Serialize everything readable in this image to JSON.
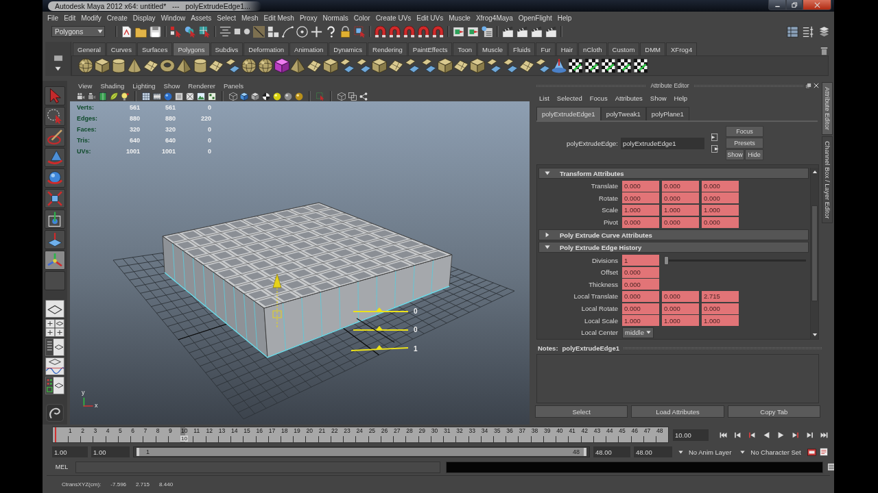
{
  "window": {
    "title": "Autodesk Maya 2012 x64: untitled*   ---   polyExtrudeEdge1..."
  },
  "menu_bar": [
    "File",
    "Edit",
    "Modify",
    "Create",
    "Display",
    "Window",
    "Assets",
    "Select",
    "Mesh",
    "Edit Mesh",
    "Proxy",
    "Normals",
    "Color",
    "Create UVs",
    "Edit UVs",
    "Muscle",
    "Xfrog4Maya",
    "OpenFlight",
    "Help"
  ],
  "status_line": {
    "menu_set": "Polygons"
  },
  "shelf": {
    "tabs": [
      {
        "label": "General",
        "selected": false
      },
      {
        "label": "Curves",
        "selected": false
      },
      {
        "label": "Surfaces",
        "selected": false
      },
      {
        "label": "Polygons",
        "selected": true
      },
      {
        "label": "Subdivs",
        "selected": false
      },
      {
        "label": "Deformation",
        "selected": false
      },
      {
        "label": "Animation",
        "selected": false
      },
      {
        "label": "Dynamics",
        "selected": false
      },
      {
        "label": "Rendering",
        "selected": false
      },
      {
        "label": "PaintEffects",
        "selected": false
      },
      {
        "label": "Toon",
        "selected": false
      },
      {
        "label": "Muscle",
        "selected": false
      },
      {
        "label": "Fluids",
        "selected": false
      },
      {
        "label": "Fur",
        "selected": false
      },
      {
        "label": "Hair",
        "selected": false
      },
      {
        "label": "nCloth",
        "selected": false
      },
      {
        "label": "Custom",
        "selected": false
      },
      {
        "label": "DMM",
        "selected": false
      },
      {
        "label": "XFrog4",
        "selected": false
      }
    ]
  },
  "toolbox": {
    "tools": [
      {
        "selected": false
      },
      {
        "selected": false
      },
      {
        "selected": false
      },
      {
        "selected": false
      },
      {
        "selected": false
      },
      {
        "selected": false
      },
      {
        "selected": false
      },
      {
        "selected": false
      },
      {
        "selected": true
      },
      {
        "selected": false
      }
    ]
  },
  "viewport": {
    "menu": [
      "View",
      "Shading",
      "Lighting",
      "Show",
      "Renderer",
      "Panels"
    ],
    "hud": [
      {
        "label": "Verts:",
        "values": [
          "561",
          "561",
          "0"
        ]
      },
      {
        "label": "Edges:",
        "values": [
          "880",
          "880",
          "220"
        ]
      },
      {
        "label": "Faces:",
        "values": [
          "320",
          "320",
          "0"
        ]
      },
      {
        "label": "Tris:",
        "values": [
          "640",
          "640",
          "0"
        ]
      },
      {
        "label": "UVs:",
        "values": [
          "1001",
          "1001",
          "0"
        ]
      }
    ],
    "manipulator_values": [
      "0",
      "0",
      "1"
    ],
    "axis_labels": [
      "y",
      "x"
    ]
  },
  "attribute_editor": {
    "title": "Attribute Editor",
    "menu": [
      "List",
      "Selected",
      "Focus",
      "Attributes",
      "Show",
      "Help"
    ],
    "tabs": [
      {
        "label": "polyExtrudeEdge1",
        "selected": true
      },
      {
        "label": "polyTweak1",
        "selected": false
      },
      {
        "label": "polyPlane1",
        "selected": false
      }
    ],
    "node_label": "polyExtrudeEdge:",
    "node_name": "polyExtrudeEdge1",
    "buttons": [
      "Focus",
      "Presets",
      "Show",
      "Hide"
    ],
    "sections": [
      {
        "title": "Transform Attributes",
        "expanded": true,
        "rows": [
          {
            "kind": "vector",
            "label": "Translate",
            "values": [
              "0.000",
              "0.000",
              "0.000"
            ]
          },
          {
            "kind": "vector",
            "label": "Rotate",
            "values": [
              "0.000",
              "0.000",
              "0.000"
            ]
          },
          {
            "kind": "vector",
            "label": "Scale",
            "values": [
              "1.000",
              "1.000",
              "1.000"
            ]
          },
          {
            "kind": "vector",
            "label": "Pivot",
            "values": [
              "0.000",
              "0.000",
              "0.000"
            ]
          }
        ]
      },
      {
        "title": "Poly Extrude Curve Attributes",
        "expanded": false
      },
      {
        "title": "Poly Extrude Edge History",
        "expanded": true,
        "rows": [
          {
            "kind": "slider",
            "label": "Divisions",
            "values": [
              "1"
            ],
            "level": 0
          },
          {
            "kind": "vector",
            "label": "Offset",
            "values": [
              "0.000"
            ]
          },
          {
            "kind": "vector",
            "label": "Thickness",
            "values": [
              "0.000"
            ]
          },
          {
            "kind": "vector",
            "label": "Local Translate",
            "values": [
              "0.000",
              "0.000",
              "2.715"
            ]
          },
          {
            "kind": "vector",
            "label": "Local Rotate",
            "values": [
              "0.000",
              "0.000",
              "0.000"
            ]
          },
          {
            "kind": "vector",
            "label": "Local Scale",
            "values": [
              "1.000",
              "1.000",
              "1.000"
            ]
          },
          {
            "kind": "dropdown",
            "label": "Local Center",
            "values": [
              "middle"
            ]
          }
        ]
      }
    ],
    "notes": {
      "label": "Notes:",
      "node": "polyExtrudeEdge1"
    },
    "bottom_buttons": [
      "Select",
      "Load Attributes",
      "Copy Tab"
    ]
  },
  "side_tabs": [
    {
      "label": "Attribute Editor",
      "selected": true
    },
    {
      "label": "Channel Box / Layer Editor",
      "selected": false
    }
  ],
  "time_slider": {
    "ticks": [
      {
        "label": "1",
        "selected": false
      },
      {
        "label": "2",
        "selected": false
      },
      {
        "label": "3",
        "selected": false
      },
      {
        "label": "4",
        "selected": false
      },
      {
        "label": "5",
        "selected": false
      },
      {
        "label": "6",
        "selected": false
      },
      {
        "label": "7",
        "selected": false
      },
      {
        "label": "8",
        "selected": false
      },
      {
        "label": "9",
        "selected": false
      },
      {
        "label": "10",
        "selected": true
      },
      {
        "label": "11",
        "selected": false
      },
      {
        "label": "12",
        "selected": false
      },
      {
        "label": "13",
        "selected": false
      },
      {
        "label": "14",
        "selected": false
      },
      {
        "label": "15",
        "selected": false
      },
      {
        "label": "16",
        "selected": false
      },
      {
        "label": "17",
        "selected": false
      },
      {
        "label": "18",
        "selected": false
      },
      {
        "label": "19",
        "selected": false
      },
      {
        "label": "20",
        "selected": false
      },
      {
        "label": "21",
        "selected": false
      },
      {
        "label": "22",
        "selected": false
      },
      {
        "label": "23",
        "selected": false
      },
      {
        "label": "24",
        "selected": false
      },
      {
        "label": "25",
        "selected": false
      },
      {
        "label": "26",
        "selected": false
      },
      {
        "label": "27",
        "selected": false
      },
      {
        "label": "28",
        "selected": false
      },
      {
        "label": "29",
        "selected": false
      },
      {
        "label": "30",
        "selected": false
      },
      {
        "label": "31",
        "selected": false
      },
      {
        "label": "32",
        "selected": false
      },
      {
        "label": "33",
        "selected": false
      },
      {
        "label": "34",
        "selected": false
      },
      {
        "label": "35",
        "selected": false
      },
      {
        "label": "36",
        "selected": false
      },
      {
        "label": "37",
        "selected": false
      },
      {
        "label": "38",
        "selected": false
      },
      {
        "label": "39",
        "selected": false
      },
      {
        "label": "40",
        "selected": false
      },
      {
        "label": "41",
        "selected": false
      },
      {
        "label": "42",
        "selected": false
      },
      {
        "label": "43",
        "selected": false
      },
      {
        "label": "44",
        "selected": false
      },
      {
        "label": "45",
        "selected": false
      },
      {
        "label": "46",
        "selected": false
      },
      {
        "label": "47",
        "selected": false
      },
      {
        "label": "48",
        "selected": false
      }
    ],
    "current_frame": "10",
    "current_time": "10.00"
  },
  "range_slider": {
    "start_time": "1.00",
    "playback_start": "1.00",
    "range_start": "1",
    "range_end": "48",
    "level": 1,
    "playback_end": "48.00",
    "end_time": "48.00",
    "anim_layer": "No Anim Layer",
    "character_set": "No Character Set"
  },
  "command_line": {
    "language": "MEL"
  },
  "help_line": {
    "label": "CtransXYZ(cm):",
    "values": [
      "-7.596",
      "2.715",
      "8.440"
    ]
  }
}
